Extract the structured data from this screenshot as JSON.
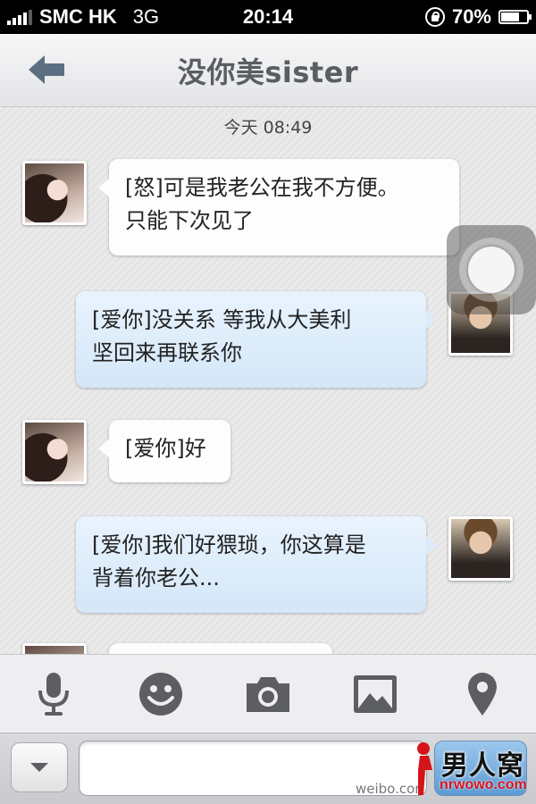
{
  "status_bar": {
    "carrier": "SMC HK",
    "network": "3G",
    "time": "20:14",
    "battery": "70%",
    "battery_level": 0.7
  },
  "nav": {
    "title": "没你美sister",
    "back_icon": "back-arrow-icon"
  },
  "chat": {
    "timestamp": "今天 08:49",
    "messages": [
      {
        "side": "in",
        "lines": [
          "[怒]可是我老公在我不方便。",
          "只能下次见了"
        ]
      },
      {
        "side": "out",
        "lines": [
          "[爱你]没关系 等我从大美利",
          "坚回来再联系你"
        ]
      },
      {
        "side": "in",
        "lines": [
          "[爱你]好"
        ]
      },
      {
        "side": "out",
        "lines": [
          "[爱你]我们好猥琐，你这算是",
          "背着你老公..."
        ]
      }
    ]
  },
  "toolbar": {
    "icons": [
      "microphone-icon",
      "emoji-icon",
      "camera-icon",
      "photo-gallery-icon",
      "location-pin-icon"
    ]
  },
  "input": {
    "value": "",
    "placeholder": ""
  },
  "watermark": {
    "weibo": "weibo.cor",
    "brand": "男人窝",
    "url": "nrwowo.com"
  },
  "colors": {
    "outgoing_bubble": "#d4e7f8",
    "incoming_bubble": "#fdfdfd",
    "title": "#5a5d62",
    "icon": "#5c5e62"
  }
}
